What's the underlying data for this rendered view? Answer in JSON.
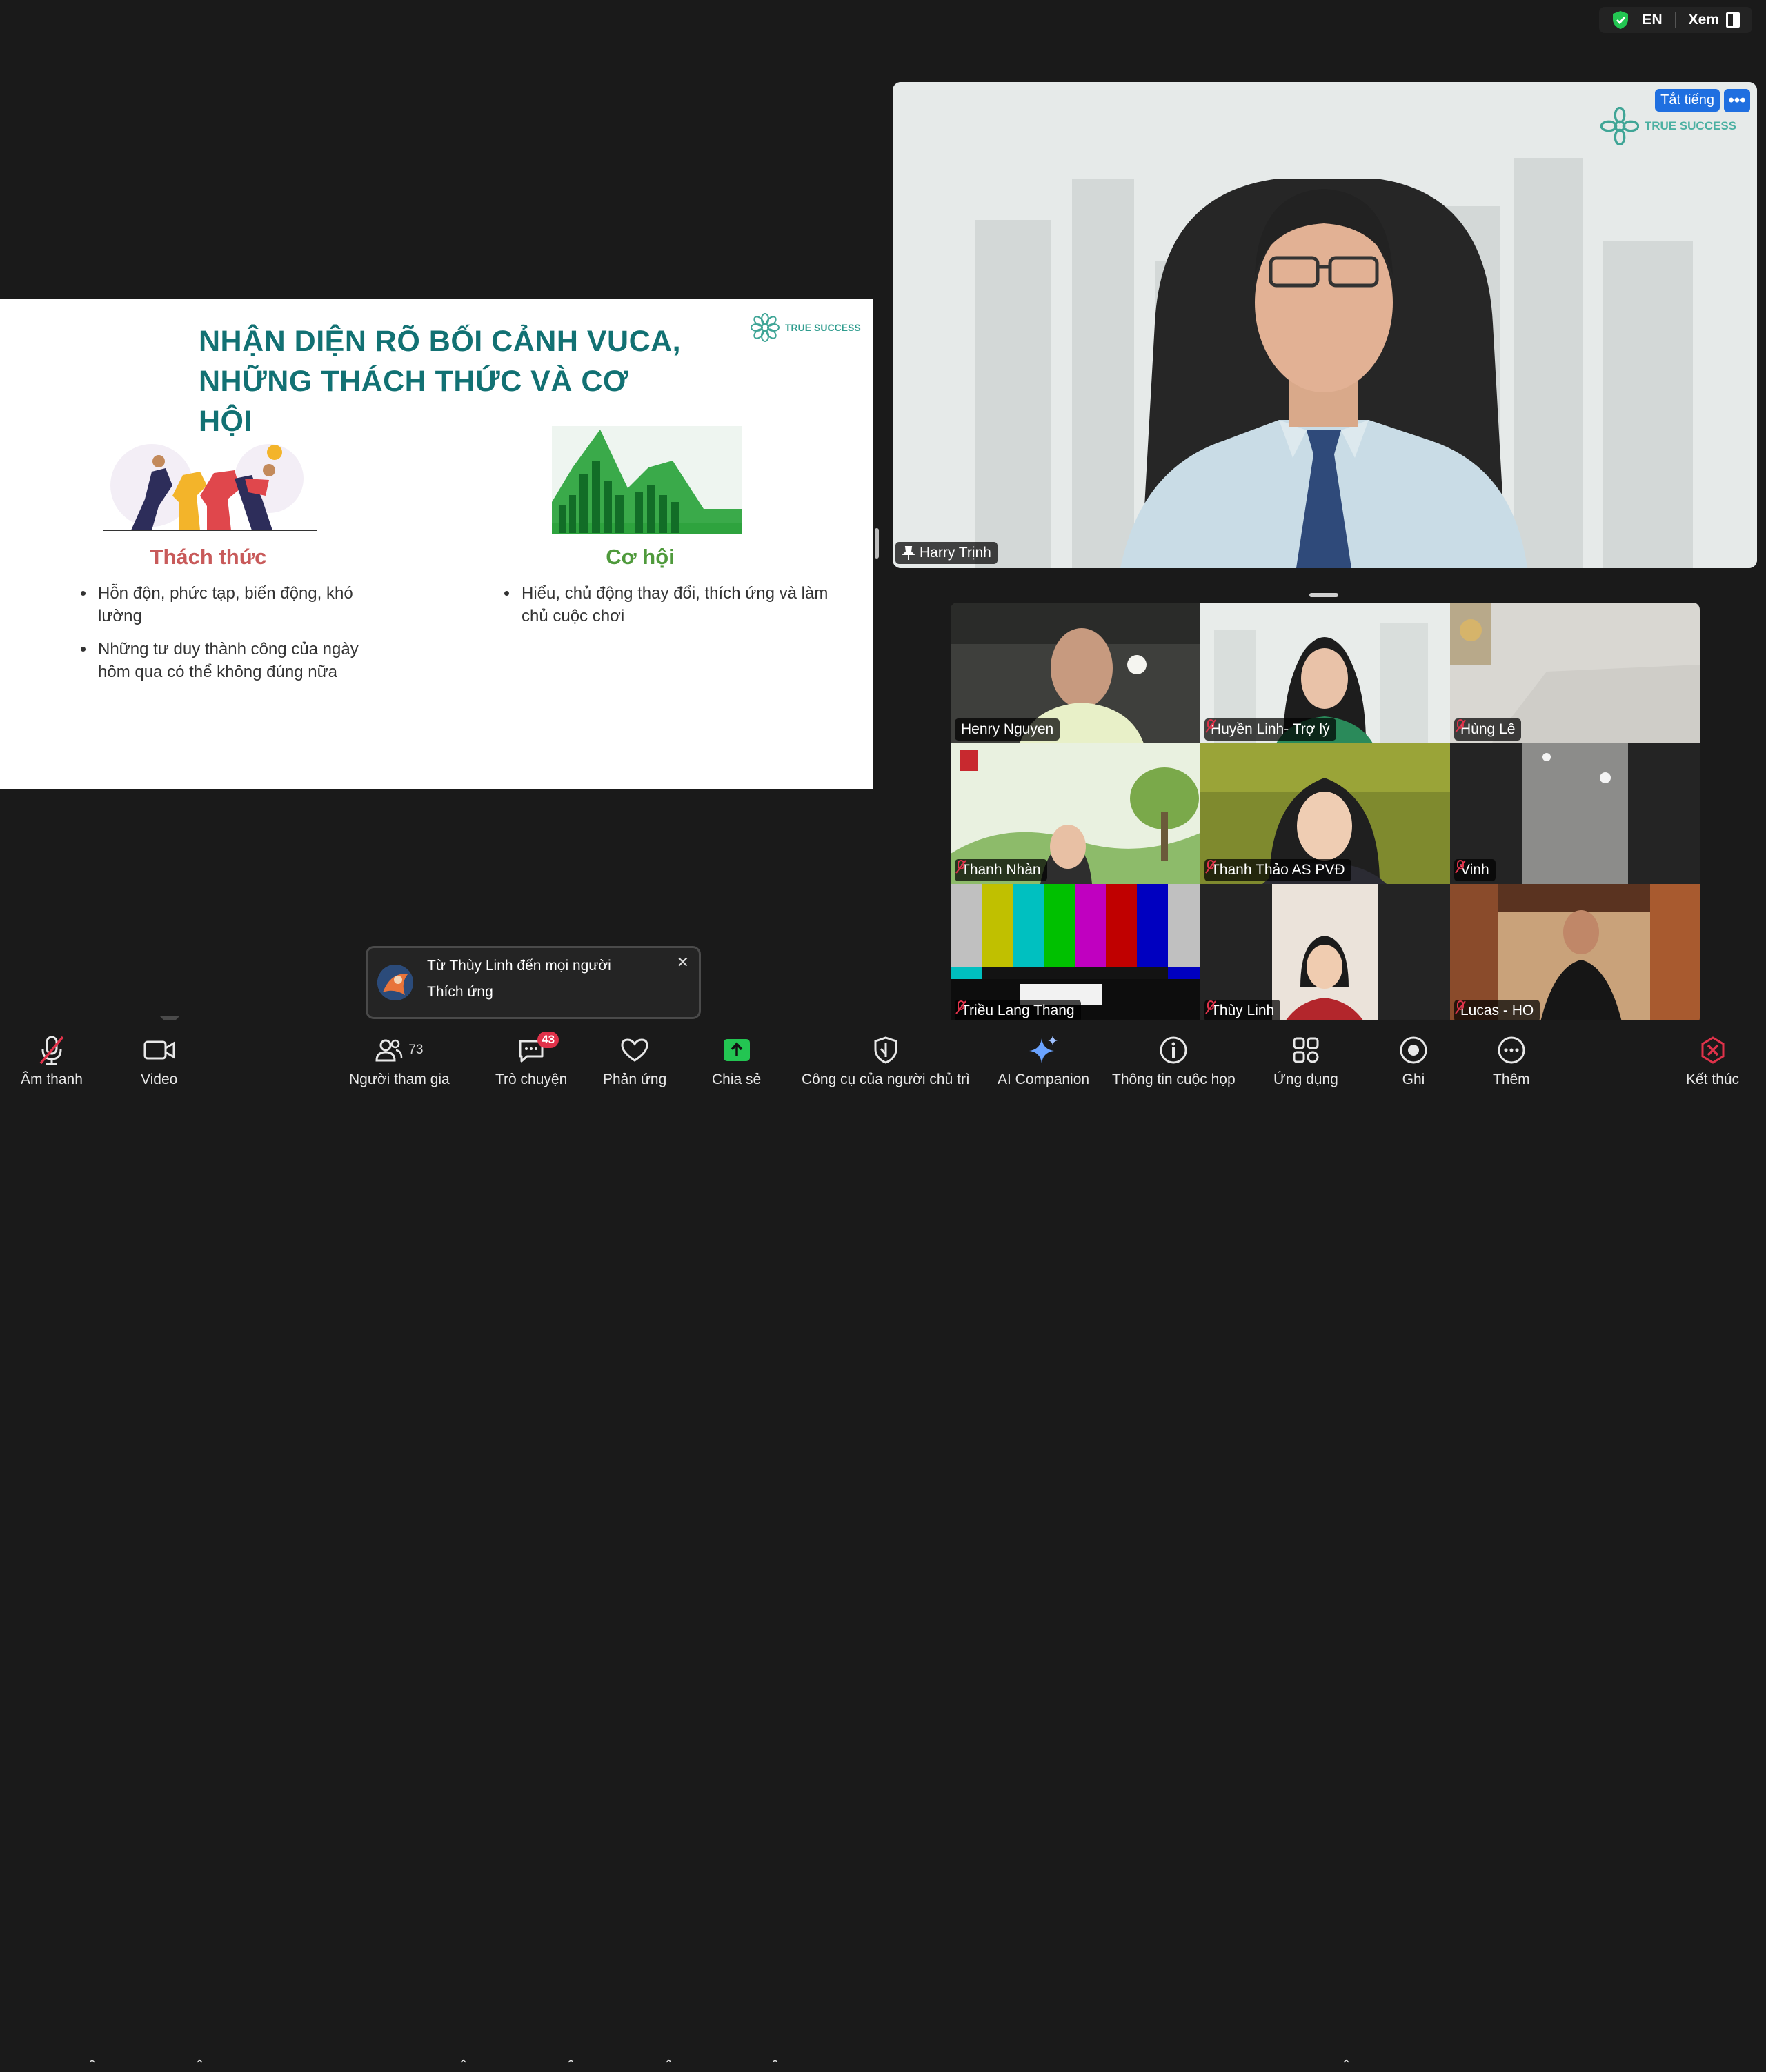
{
  "topbar": {
    "language": "EN",
    "view_label": "Xem"
  },
  "slide": {
    "title_line1": "NHẬN DIỆN RÕ BỐI CẢNH VUCA,",
    "title_line2": "NHỮNG THÁCH THỨC VÀ CƠ HỘI",
    "logo_text": "TRUE SUCCESS",
    "challenge_heading": "Thách thức",
    "challenge_items": [
      "Hỗn độn, phức tạp, biến động, khó lường",
      "Những tư duy thành công của ngày hôm qua có thể không đúng nữa"
    ],
    "opportunity_heading": "Cơ hội",
    "opportunity_items": [
      "Hiểu, chủ động thay đổi, thích ứng và làm chủ cuộc chơi"
    ]
  },
  "speaker": {
    "name": "Harry Trịnh",
    "mute_all_label": "Tắt tiếng",
    "more_label": "•••",
    "logo_text": "TRUE SUCCESS"
  },
  "gallery": [
    {
      "name": "Henry Nguyen",
      "muted": false
    },
    {
      "name": "Huyền Linh- Trợ lý",
      "muted": true
    },
    {
      "name": "Hùng Lê",
      "muted": true
    },
    {
      "name": "Thanh Nhàn",
      "muted": true
    },
    {
      "name": "Thanh Thảo AS PVĐ",
      "muted": true
    },
    {
      "name": "Vinh",
      "muted": true
    },
    {
      "name": "Triều Lang Thang",
      "muted": true
    },
    {
      "name": "Thùy Linh",
      "muted": true
    },
    {
      "name": "Lucas - HO",
      "muted": true
    }
  ],
  "notification": {
    "from": "Từ Thùy Linh đến mọi người",
    "message": "Thích ứng",
    "close": "✕"
  },
  "toolbar": {
    "audio": "Âm thanh",
    "video": "Video",
    "participants": "Người tham gia",
    "participants_count": "73",
    "chat": "Trò chuyện",
    "chat_badge": "43",
    "reactions": "Phản ứng",
    "share": "Chia sẻ",
    "host_tools": "Công cụ của người chủ trì",
    "ai": "AI Companion",
    "info": "Thông tin cuộc họp",
    "apps": "Ứng dụng",
    "record": "Ghi",
    "more": "Thêm",
    "end": "Kết thúc"
  },
  "colors": {
    "accent_blue": "#1f6fe0",
    "slide_title": "#127173",
    "challenge": "#c85a5a",
    "opportunity": "#4f9a3c",
    "end_red": "#e0324a",
    "share_green": "#23c552"
  }
}
